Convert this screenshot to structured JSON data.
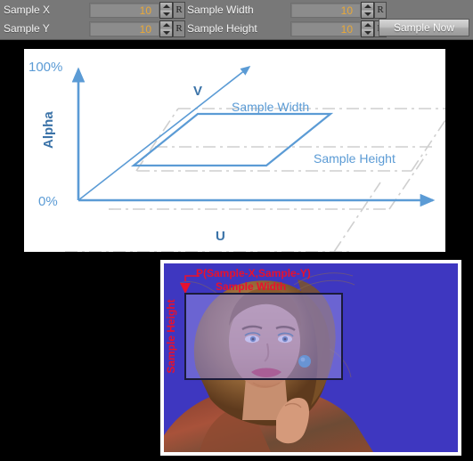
{
  "toolbar": {
    "fields": [
      {
        "label": "Sample X",
        "value": "10",
        "reset": "R"
      },
      {
        "label": "Sample Y",
        "value": "10",
        "reset": "R"
      },
      {
        "label": "Sample Width",
        "value": "10",
        "reset": "R"
      },
      {
        "label": "Sample Height",
        "value": "10",
        "reset": "R"
      }
    ],
    "sample_now_label": "Sample Now",
    "colors": {
      "background": "#787878",
      "value_text": "#e8a838",
      "label_text": "#f2f2f2"
    }
  },
  "diagram": {
    "axis_y_top_label": "100%",
    "axis_y_bottom_label": "0%",
    "axis_y_title": "Alpha",
    "axis_x_title": "U",
    "axis_depth_title": "V",
    "annotation_width": "Sample Width",
    "annotation_height": "Sample Height",
    "colors": {
      "accent": "#5b9bd5",
      "grid": "#d0d0d0",
      "panel": "#ffffff"
    }
  },
  "photo": {
    "point_label": "P(Sample-X,Sample-Y)",
    "width_label": "Sample Width",
    "height_label": "Sample Height",
    "colors": {
      "annotation": "#e8112d",
      "backdrop": "#3c35bb",
      "selection_stroke": "#1b1b3a"
    }
  }
}
